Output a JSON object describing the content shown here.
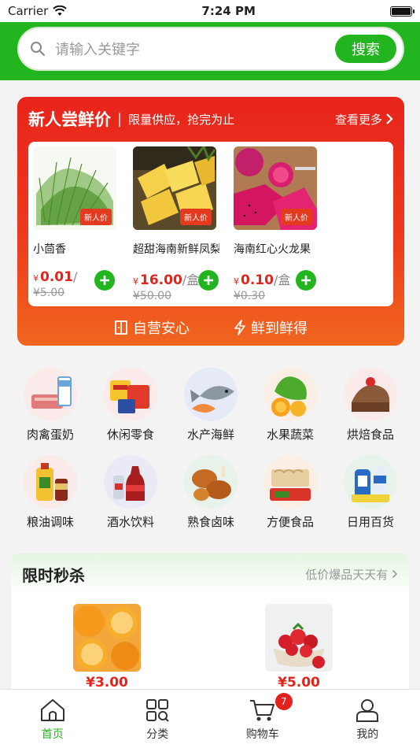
{
  "status_bar": {
    "carrier": "Carrier",
    "time": "7:24 PM"
  },
  "search": {
    "placeholder": "请输入关键字",
    "button": "搜索"
  },
  "new_user": {
    "title": "新人尝鲜价",
    "subtitle": "限量供应，抢完为止",
    "more": "查看更多",
    "products": [
      {
        "name": "小茴香",
        "tag": "新人价",
        "yen": "¥",
        "price": "0.01",
        "unit": "/",
        "original": "¥5.00"
      },
      {
        "name": "超甜海南新鲜凤梨",
        "tag": "新人价",
        "yen": "¥",
        "price": "16.00",
        "unit": "/盒",
        "original": "¥50.00"
      },
      {
        "name": "海南红心火龙果",
        "tag": "新人价",
        "yen": "¥",
        "price": "0.10",
        "unit": "/盒",
        "original": "¥0.30"
      }
    ],
    "footer": [
      "自营安心",
      "鲜到鲜得"
    ]
  },
  "categories": [
    "肉禽蛋奶",
    "休闲零食",
    "水产海鲜",
    "水果蔬菜",
    "烘焙食品",
    "粮油调味",
    "酒水饮料",
    "熟食卤味",
    "方便食品",
    "日用百货"
  ],
  "flash_sale": {
    "title": "限时秒杀",
    "more": "低价爆品天天有",
    "items": [
      {
        "price": "¥3.00"
      },
      {
        "price": "¥5.00"
      }
    ]
  },
  "tabbar": {
    "tabs": [
      "首页",
      "分类",
      "购物车",
      "我的"
    ],
    "cart_badge": "7"
  },
  "colors": {
    "brand_green": "#22b51f",
    "promo_red": "#e8241c",
    "price_red": "#e0251c"
  }
}
